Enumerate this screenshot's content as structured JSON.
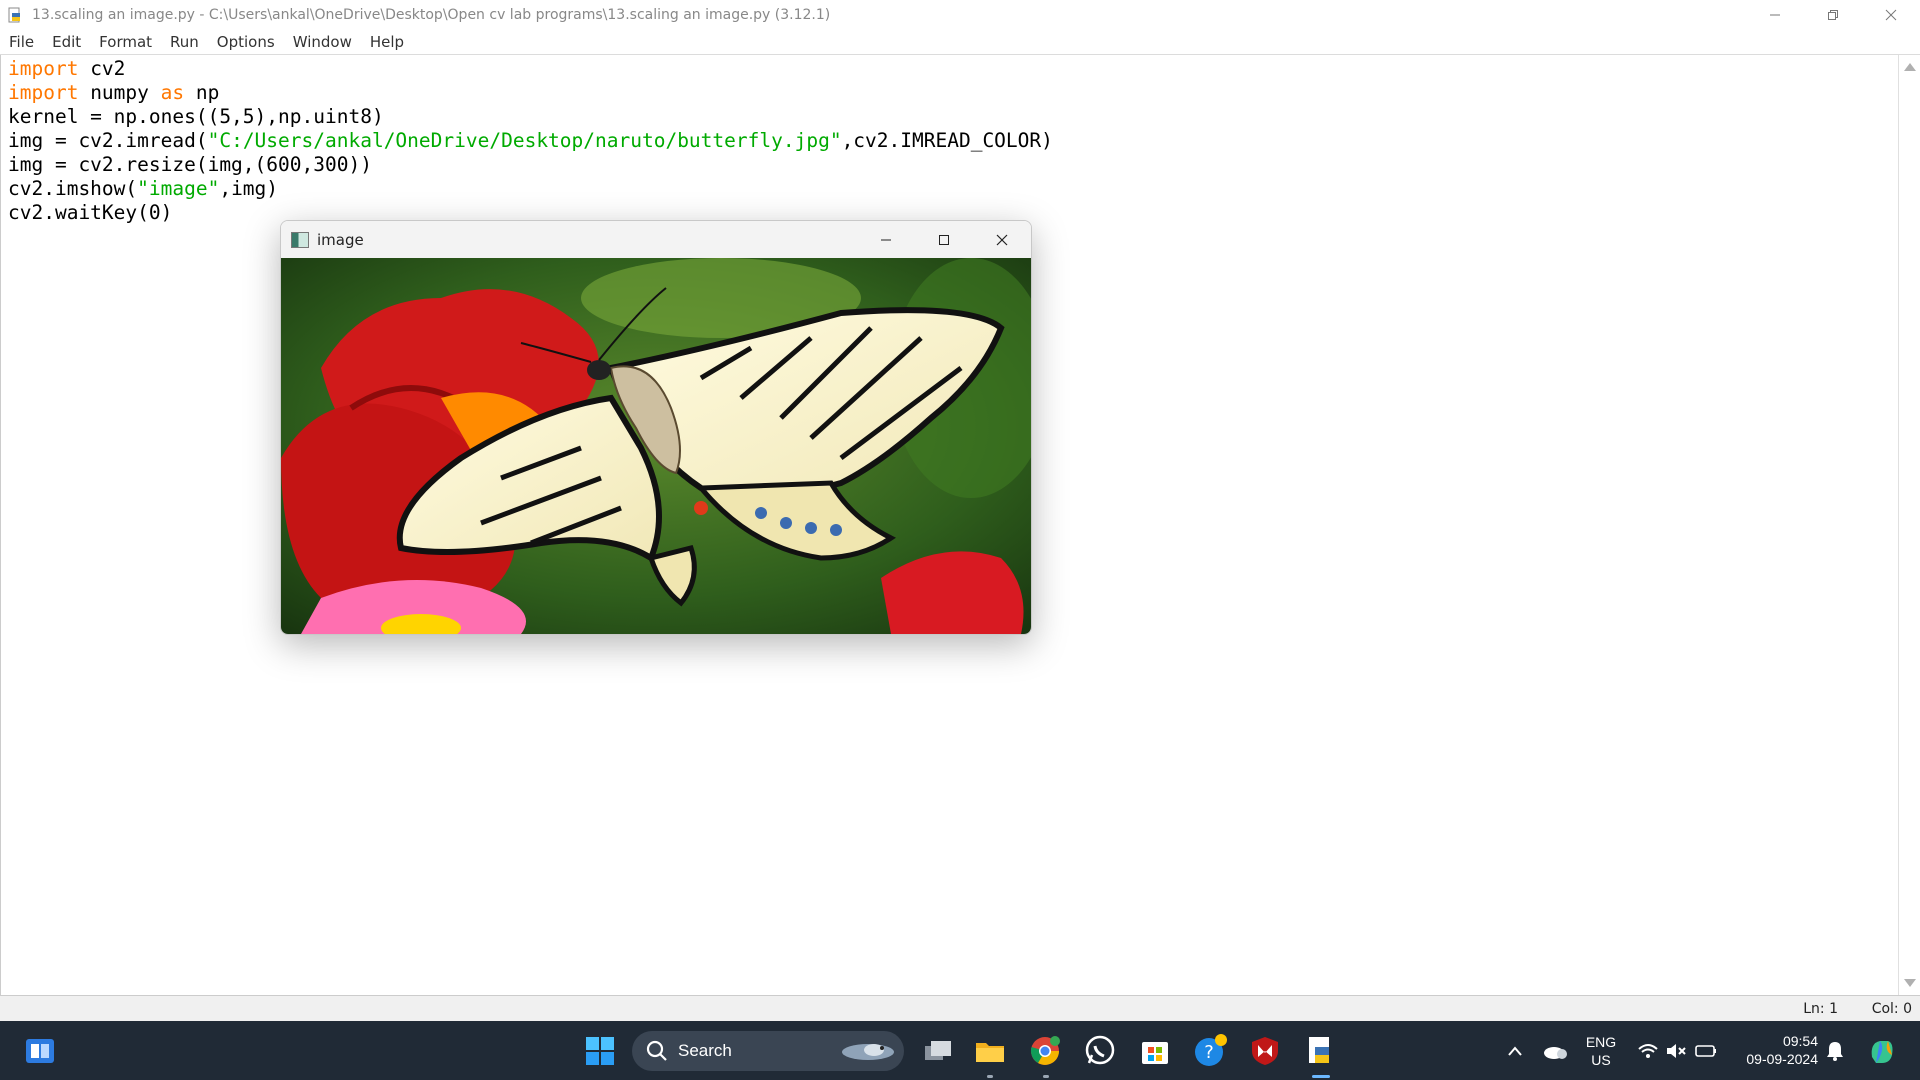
{
  "window": {
    "title": "13.scaling an image.py - C:\\Users\\ankal\\OneDrive\\Desktop\\Open cv lab programs\\13.scaling an image.py (3.12.1)"
  },
  "menu": [
    "File",
    "Edit",
    "Format",
    "Run",
    "Options",
    "Window",
    "Help"
  ],
  "code": {
    "l1_kw": "import",
    "l1_rest": " cv2",
    "l2_kw": "import",
    "l2_mid": " numpy ",
    "l2_kw2": "as",
    "l2_rest": " np",
    "l3": "kernel = np.ones((5,5),np.uint8)",
    "l4_pre": "img = cv2.imread(",
    "l4_str": "\"C:/Users/ankal/OneDrive/Desktop/naruto/butterfly.jpg\"",
    "l4_post": ",cv2.IMREAD_COLOR)",
    "l5": "img = cv2.resize(img,(600,300))",
    "l6_pre": "cv2.imshow(",
    "l6_str": "\"image\"",
    "l6_post": ",img)",
    "l7": "cv2.waitKey(0)"
  },
  "status": {
    "line": "Ln: 1",
    "col": "Col: 0"
  },
  "image_window": {
    "title": "image",
    "content": "butterfly-photo"
  },
  "taskbar": {
    "search_label": "Search",
    "lang_top": "ENG",
    "lang_bottom": "US",
    "time": "09:54",
    "date": "09-09-2024"
  },
  "colors": {
    "keyword": "#ff7700",
    "string": "#00aa00",
    "taskbar": "#202a36"
  }
}
